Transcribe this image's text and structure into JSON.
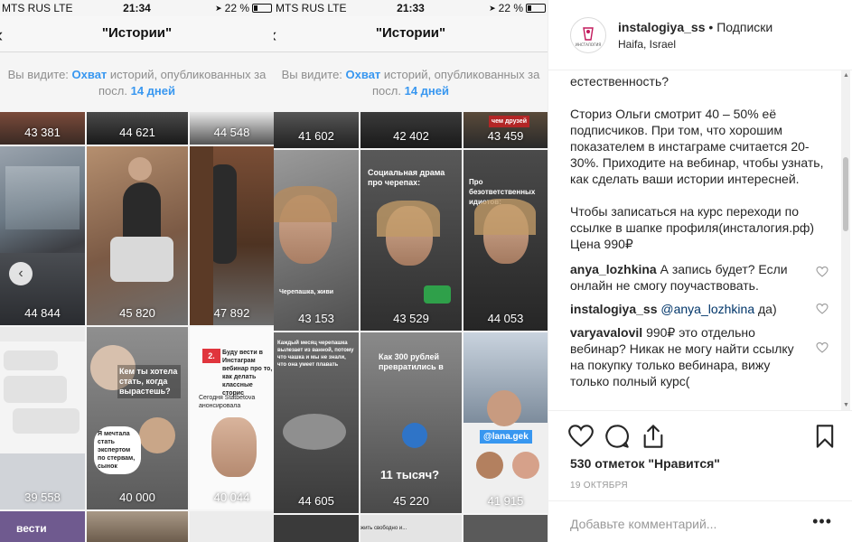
{
  "phones": [
    {
      "carrier": "MTS RUS  LTE",
      "time": "21:34",
      "battery": "22 %",
      "back": "‹",
      "title": "\"Истории\"",
      "subtitle_prefix": "Вы видите: ",
      "subtitle_link1": "Охват",
      "subtitle_mid": " историй, опубликованных за",
      "subtitle_line2_prefix": "посл. ",
      "subtitle_link2": "14 дней",
      "counts": [
        "43 381",
        "44 621",
        "44 548",
        "44 844",
        "45 820",
        "47 892",
        "39 558",
        "40 000",
        "40 044"
      ],
      "overlays": {
        "story8": "Кем ты хотела стать, когда вырастешь?",
        "story8b": "Я мечтала стать экспертом по стервам, сынок",
        "story9_num": "2.",
        "story9": "Буду вести в Инстаграм вебинар про то, как делать классные сторис",
        "story9b": "Сегодня Statbetova анонсировала",
        "story10": "вести"
      }
    },
    {
      "carrier": "MTS RUS  LTE",
      "time": "21:33",
      "battery": "22 %",
      "back": "‹",
      "title": "\"Истории\"",
      "subtitle_prefix": "Вы видите: ",
      "subtitle_link1": "Охват",
      "subtitle_mid": " историй, опубликованных за",
      "subtitle_line2_prefix": "посл. ",
      "subtitle_link2": "14 дней",
      "counts": [
        "41 602",
        "42 402",
        "43 459",
        "43 153",
        "43 529",
        "44 053",
        "44 605",
        "45 220",
        "41 915"
      ],
      "overlays": {
        "top3": "чем друзей",
        "s5": "Социальная драма про черепах:",
        "s4": "Черепашка, живи",
        "s6": "Про безответственных идиотов:",
        "s7": "Каждый месяц черепашка вылезает из ванной, потому что чашка и мы не знали, что она умеет плавать",
        "s8": "Как 300 рублей превратились в",
        "s8b": "11 тысяч?",
        "s9": "@lana.gek",
        "bottom": "...верстать бояться и жить свободно и..."
      }
    }
  ],
  "sidebar": {
    "username": "instalogiya_ss",
    "separator": " • ",
    "follow": "Подписки",
    "location": "Haifa, Israel",
    "avatar_text": "ИНСТАЛОГИЯ",
    "caption": [
      "естественность?",
      "Сториз Ольги смотрит 40 – 50% её подписчиков. При том, что хорошим показателем в инстаграме считается 20-30%. Приходите на вебинар, чтобы узнать, как сделать ваши истории интересней.",
      "Чтобы записаться на курс переходи по ссылке в шапке профиля(инсталогия.рф) Цена 990₽"
    ],
    "comments": [
      {
        "user": "anya_lozhkina",
        "text": "А запись будет? Если онлайн не смогу поучаствовать.",
        "mention": ""
      },
      {
        "user": "instalogiya_ss",
        "text": " да)",
        "mention": "@anya_lozhkina"
      },
      {
        "user": "varyavalovil",
        "text": "990₽ это отдельно вебинар? Никак не могу найти ссылку на покупку только вебинара, вижу только полный курс(",
        "mention": ""
      }
    ],
    "likes": "530 отметок \"Нравится\"",
    "date": "19 ОКТЯБРЯ",
    "comment_placeholder": "Добавьте комментарий...",
    "more": "•••"
  }
}
